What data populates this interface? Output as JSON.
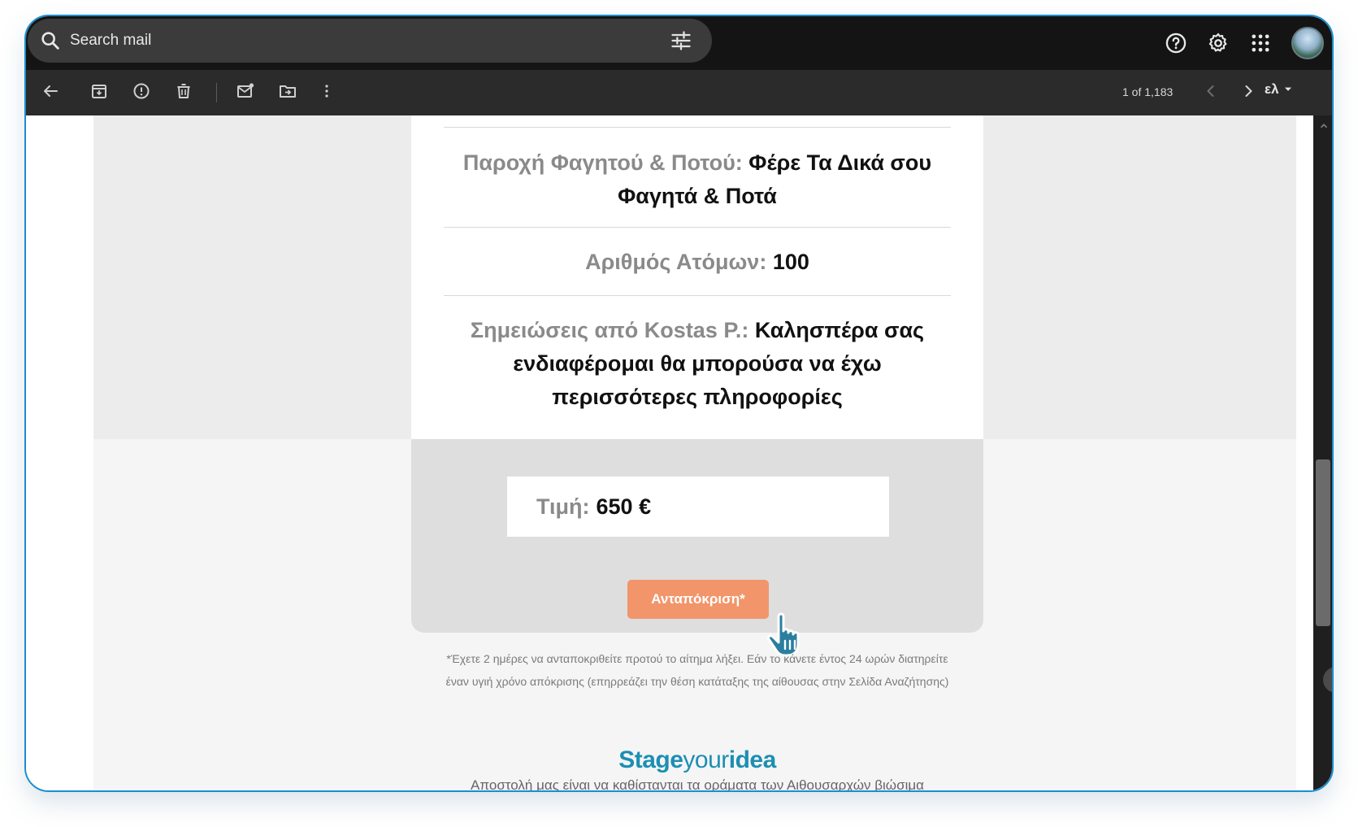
{
  "search": {
    "placeholder": "Search mail"
  },
  "icons": {
    "search": "search-icon",
    "tune": "tune-icon",
    "help": "help-icon",
    "settings": "gear-icon",
    "apps": "apps-grid-icon",
    "back": "arrow-back-icon",
    "archive": "archive-icon",
    "spam": "report-spam-icon",
    "delete": "trash-icon",
    "mark_unread": "mark-unread-icon",
    "move": "move-to-icon",
    "more": "more-vert-icon",
    "prev": "chevron-left-icon",
    "next": "chevron-right-icon"
  },
  "toolbar": {
    "pager": "1 of 1,183",
    "language": "ελ"
  },
  "email": {
    "catering": {
      "label": "Παροχή Φαγητού & Ποτού:",
      "value": "Φέρε Τα Δικά σου Φαγητά & Ποτά"
    },
    "guests": {
      "label": "Αριθμός Ατόμων:",
      "value": "100"
    },
    "notes": {
      "label": "Σημειώσεις από Kostas P.:",
      "value": "Καλησπέρα σας ενδιαφέρομαι θα μπορούσα να έχω περισσότερες πληροφορίες"
    },
    "price": {
      "label": "Τιμή:",
      "value": "650 €"
    },
    "reply_button": "Ανταπόκριση*",
    "disclaimer_line1": "*Έχετε 2 ημέρες να ανταποκριθείτε προτού το αίτημα λήξει. Εάν το κάνετε έντος 24 ωρών διατηρείτε",
    "disclaimer_line2": "έναν υγιή χρόνο απόκρισης (επηρρεάζει την θέση κατάταξης της αίθουσας στην Σελίδα Αναζήτησης)",
    "logo": {
      "part1": "Stage",
      "part2": "your",
      "part3": "idea"
    },
    "mission": "Αποστολή μας είναι να καθίστανται τα οράματα των Αιθουσαρχών βιώσιμα"
  },
  "colors": {
    "accent_button": "#f2956b",
    "brand": "#1c8fb3",
    "window_border": "#1a8fd1"
  }
}
